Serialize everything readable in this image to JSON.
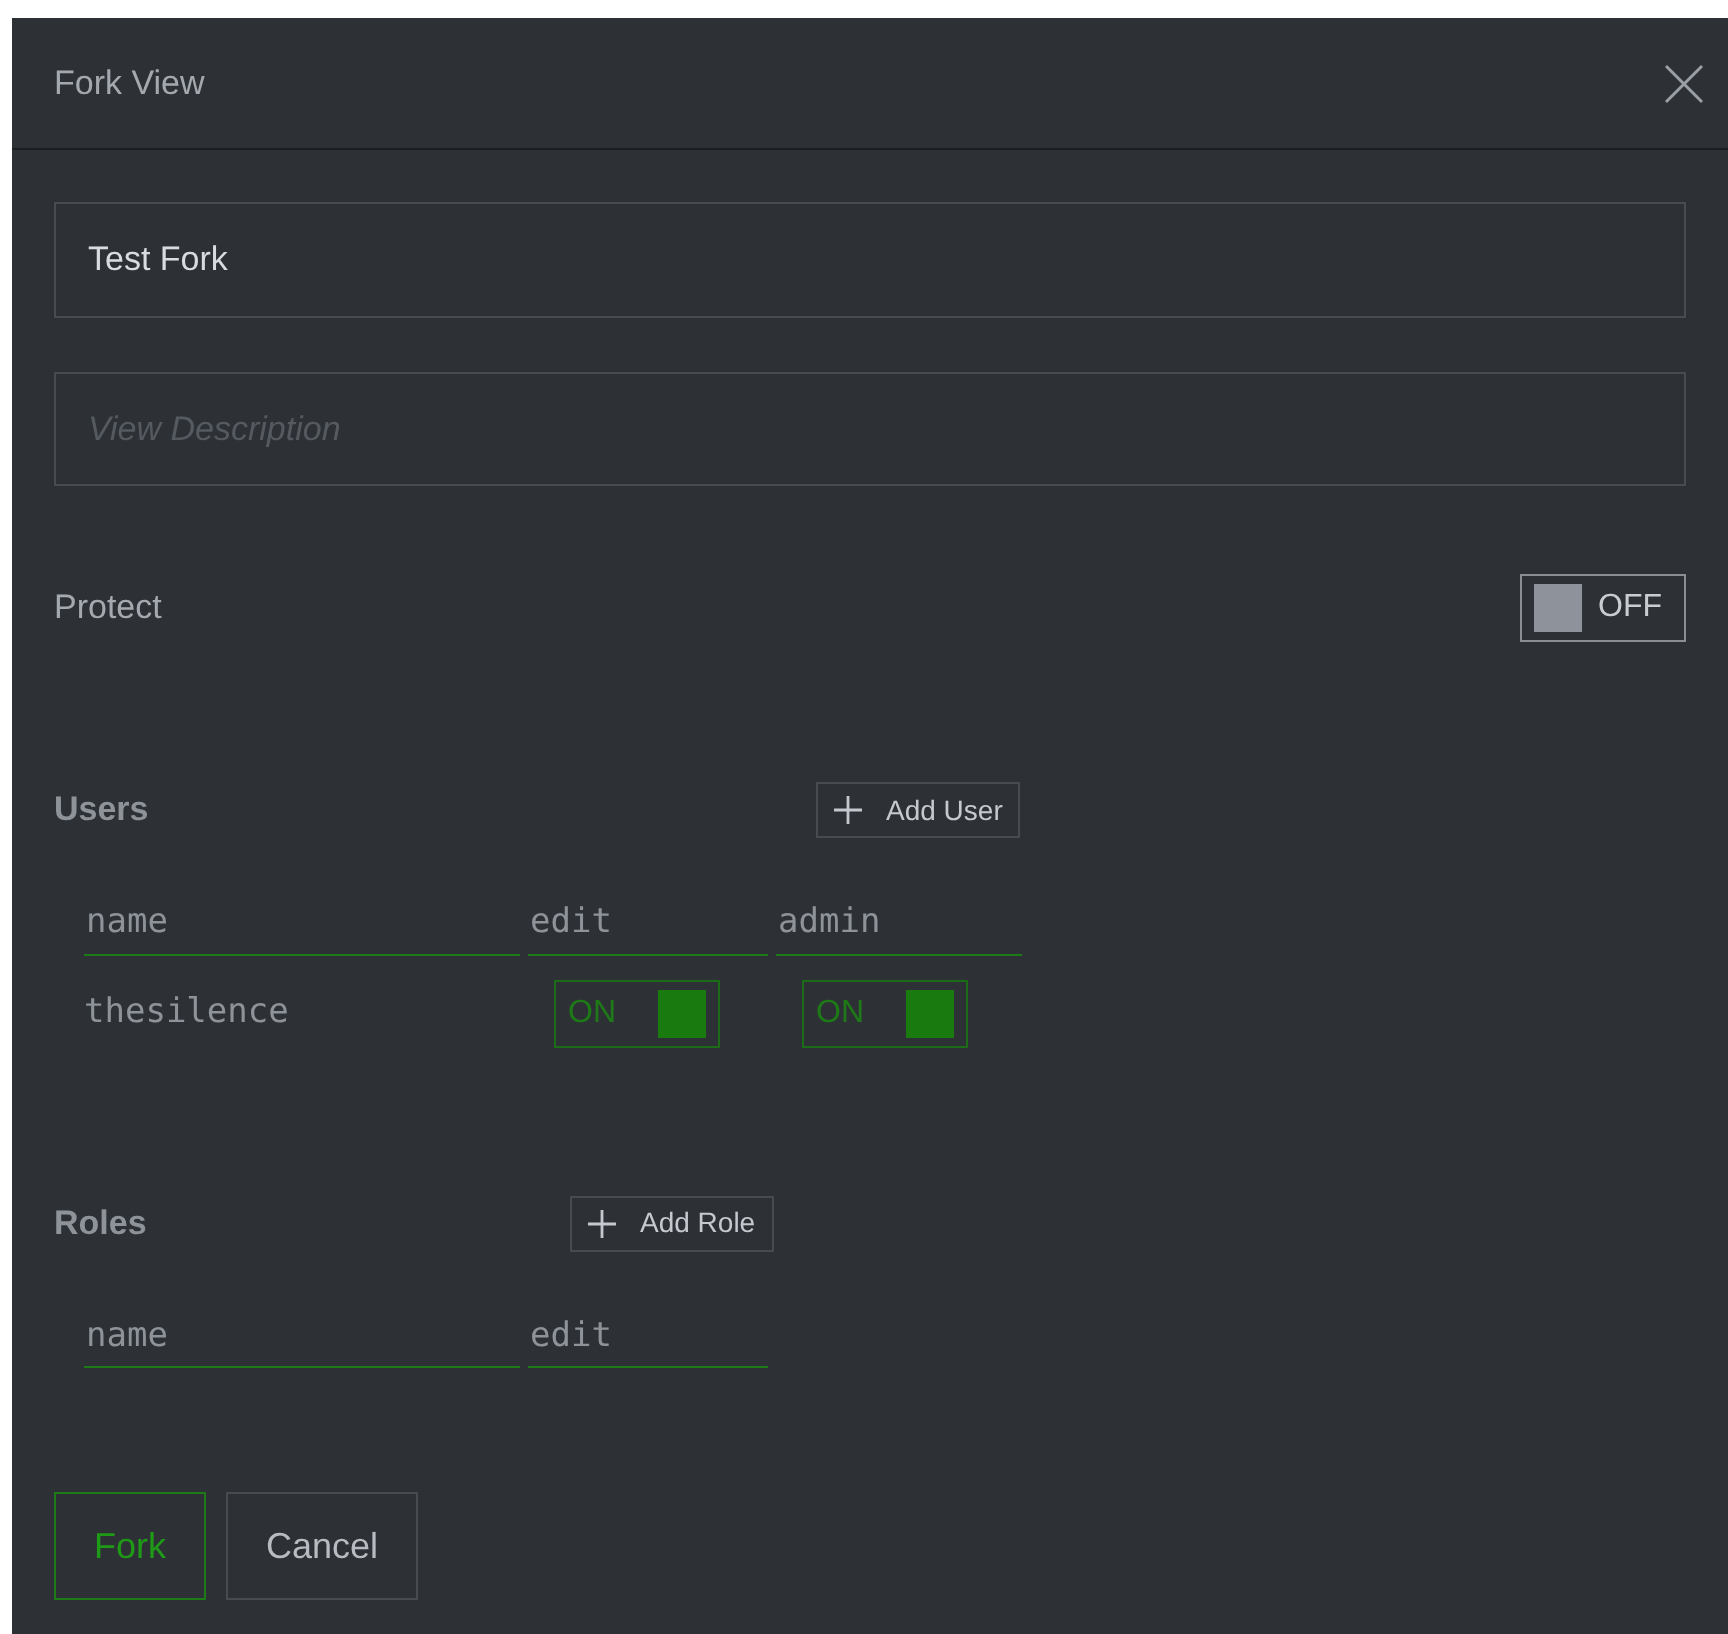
{
  "dialog": {
    "title": "Fork View"
  },
  "name_field": {
    "value": "Test Fork"
  },
  "description_field": {
    "placeholder": "View Description"
  },
  "protect": {
    "label": "Protect",
    "on": false,
    "state_text": "OFF"
  },
  "users": {
    "heading": "Users",
    "add_button": "Add User",
    "columns": [
      "name",
      "edit",
      "admin"
    ],
    "rows": [
      {
        "name": "thesilence",
        "toggles": [
          {
            "on": true,
            "state_text": "ON"
          },
          {
            "on": true,
            "state_text": "ON"
          }
        ]
      }
    ]
  },
  "roles": {
    "heading": "Roles",
    "add_button": "Add Role",
    "columns": [
      "name",
      "edit"
    ]
  },
  "buttons": [
    {
      "label": "Fork",
      "kind": "primary"
    },
    {
      "label": "Cancel",
      "kind": "secondary"
    }
  ]
}
